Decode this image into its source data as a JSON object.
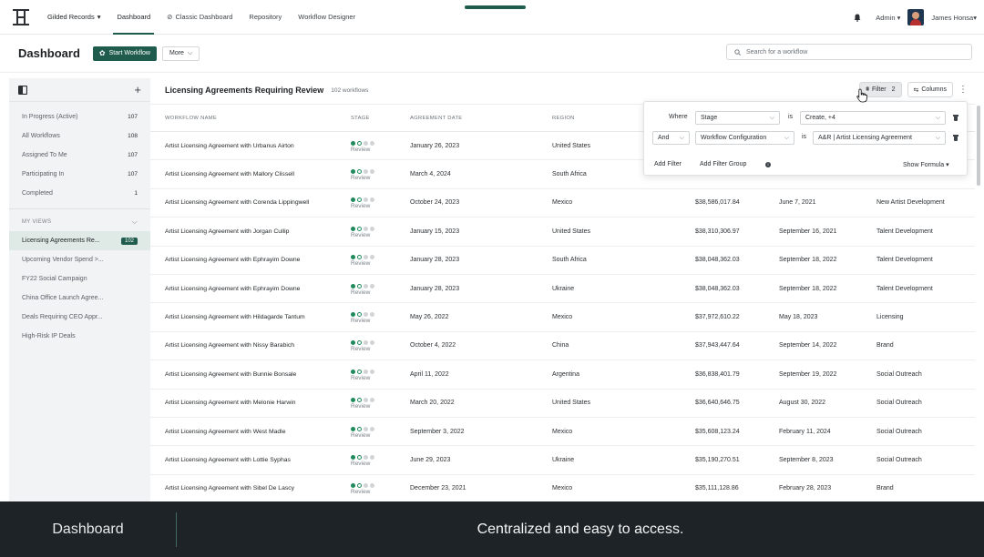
{
  "topnav": {
    "org_label": "Gilded Records",
    "items": [
      "Dashboard",
      "Classic Dashboard",
      "Repository",
      "Workflow Designer"
    ],
    "user_role": "Admin",
    "user_name": "James Honsa"
  },
  "header": {
    "title": "Dashboard",
    "start_workflow_label": "Start Workflow",
    "more_label": "More",
    "search_placeholder": "Search for a workflow"
  },
  "sidebar": {
    "groups": [
      {
        "label": "In Progress (Active)",
        "count": "107"
      },
      {
        "label": "All Workflows",
        "count": "108"
      },
      {
        "label": "Assigned To Me",
        "count": "107"
      },
      {
        "label": "Participating In",
        "count": "107"
      },
      {
        "label": "Completed",
        "count": "1"
      }
    ],
    "my_views_label": "MY VIEWS",
    "views": [
      {
        "label": "Licensing Agreements Re...",
        "badge": "102"
      },
      {
        "label": "Upcoming Vendor Spend >..."
      },
      {
        "label": "FY22 Social Campaign"
      },
      {
        "label": "China Office Launch Agree..."
      },
      {
        "label": "Deals Requiring CEO Appr..."
      },
      {
        "label": "High-Risk IP Deals"
      }
    ]
  },
  "list": {
    "title": "Licensing Agreements Requiring Review",
    "count": "102 workflows",
    "filter_label": "Filter",
    "filter_count": "2",
    "columns_label": "Columns",
    "headers": [
      "WORKFLOW NAME",
      "STAGE",
      "AGREEMENT DATE",
      "REGION",
      "",
      "",
      ""
    ],
    "rows": [
      {
        "name": "Artist Licensing Agreement with Urbanus Airton",
        "stage": "Review",
        "date": "January 26, 2023",
        "region": "United States",
        "amount": "",
        "date2": "",
        "dept": ""
      },
      {
        "name": "Artist Licensing Agreement with Mallory Clissell",
        "stage": "Review",
        "date": "March 4, 2024",
        "region": "South Africa",
        "amount": "",
        "date2": "",
        "dept": ""
      },
      {
        "name": "Artist Licensing Agreement with Corenda Lippingwell",
        "stage": "Review",
        "date": "October 24, 2023",
        "region": "Mexico",
        "amount": "$38,586,017.84",
        "date2": "June 7, 2021",
        "dept": "New Artist Development"
      },
      {
        "name": "Artist Licensing Agreement with Jorgan Cullip",
        "stage": "Review",
        "date": "January 15, 2023",
        "region": "United States",
        "amount": "$38,310,306.97",
        "date2": "September 16, 2021",
        "dept": "Talent Development"
      },
      {
        "name": "Artist Licensing Agreement with Ephrayim Downe",
        "stage": "Review",
        "date": "January 28, 2023",
        "region": "South Africa",
        "amount": "$38,048,362.03",
        "date2": "September 18, 2022",
        "dept": "Talent Development"
      },
      {
        "name": "Artist Licensing Agreement with Ephrayim Downe",
        "stage": "Review",
        "date": "January 28, 2023",
        "region": "Ukraine",
        "amount": "$38,048,362.03",
        "date2": "September 18, 2022",
        "dept": "Talent Development"
      },
      {
        "name": "Artist Licensing Agreement with Hildagarde Tantum",
        "stage": "Review",
        "date": "May 26, 2022",
        "region": "Mexico",
        "amount": "$37,972,610.22",
        "date2": "May 18, 2023",
        "dept": "Licensing"
      },
      {
        "name": "Artist Licensing Agreement with Nissy Barabich",
        "stage": "Review",
        "date": "October 4, 2022",
        "region": "China",
        "amount": "$37,943,447.64",
        "date2": "September 14, 2022",
        "dept": "Brand"
      },
      {
        "name": "Artist Licensing Agreement with Bunnie Bonsale",
        "stage": "Review",
        "date": "April 11, 2022",
        "region": "Argentina",
        "amount": "$36,838,401.79",
        "date2": "September 19, 2022",
        "dept": "Social Outreach"
      },
      {
        "name": "Artist Licensing Agreement with Melonie Harwin",
        "stage": "Review",
        "date": "March 20, 2022",
        "region": "United States",
        "amount": "$36,640,646.75",
        "date2": "August 30, 2022",
        "dept": "Social Outreach"
      },
      {
        "name": "Artist Licensing Agreement with West Madle",
        "stage": "Review",
        "date": "September 3, 2022",
        "region": "Mexico",
        "amount": "$35,608,123.24",
        "date2": "February 11, 2024",
        "dept": "Social Outreach"
      },
      {
        "name": "Artist Licensing Agreement with Lottie Syphas",
        "stage": "Review",
        "date": "June 29, 2023",
        "region": "Ukraine",
        "amount": "$35,190,270.51",
        "date2": "September 8, 2023",
        "dept": "Social Outreach"
      },
      {
        "name": "Artist Licensing Agreement with Sibel De Lascy",
        "stage": "Review",
        "date": "December 23, 2021",
        "region": "Mexico",
        "amount": "$35,111,128.86",
        "date2": "February 28, 2023",
        "dept": "Brand"
      }
    ]
  },
  "filter_popover": {
    "where_label": "Where",
    "row1_field": "Stage",
    "row1_op": "is",
    "row1_value": "Create, +4",
    "conj": "And",
    "row2_field": "Workflow Configuration",
    "row2_op": "is",
    "row2_value": "A&R | Artist Licensing Agreement",
    "add_filter": "Add Filter",
    "add_filter_group": "Add Filter Group",
    "show_formula": "Show Formula"
  },
  "banner": {
    "left": "Dashboard",
    "right": "Centralized and easy to access."
  },
  "colors": {
    "brand": "#1f5c4e",
    "stage_done": "#1f8a5c",
    "banner_bg": "#1e2327"
  }
}
